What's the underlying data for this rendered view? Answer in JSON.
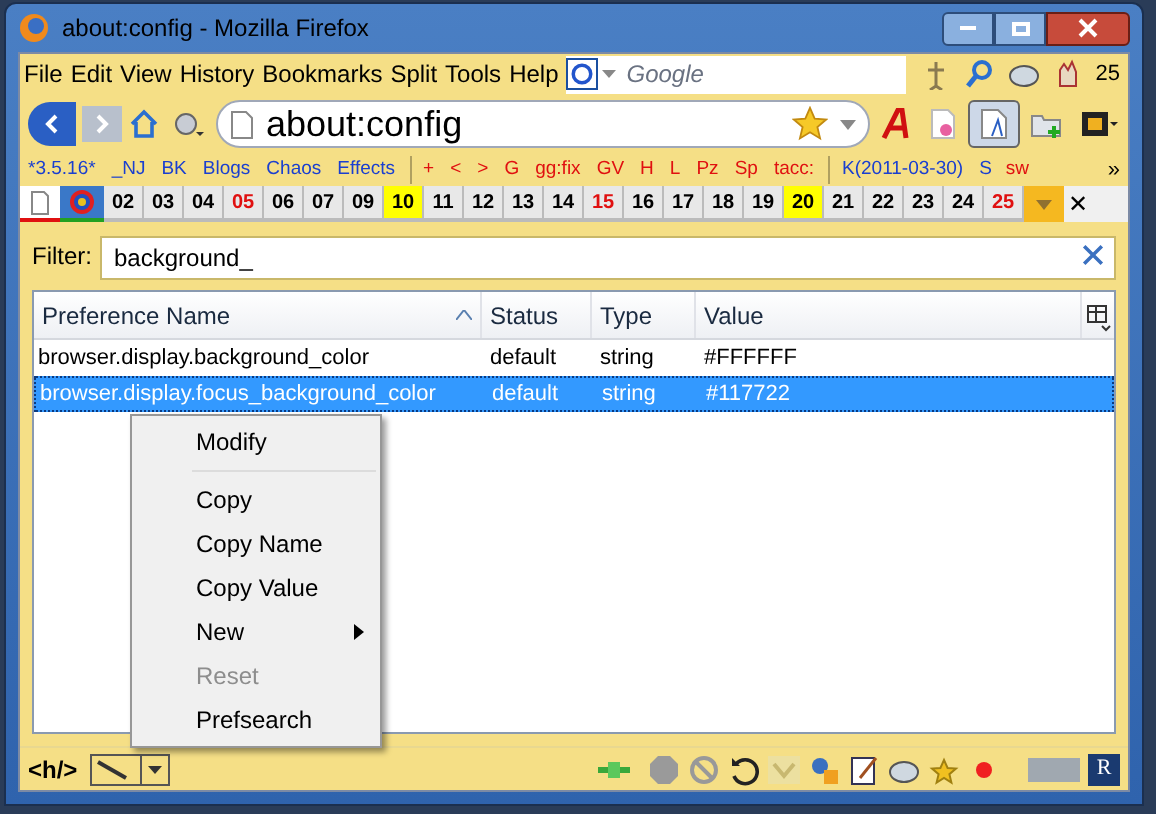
{
  "window": {
    "title": "about:config - Mozilla Firefox"
  },
  "menu": [
    "File",
    "Edit",
    "View",
    "History",
    "Bookmarks",
    "Split",
    "Tools",
    "Help"
  ],
  "search": {
    "placeholder": "Google"
  },
  "toolbar_count": "25",
  "url": "about:config",
  "bookmark_groups": [
    {
      "color": "#1a3fd0",
      "items": [
        "*3.5.16*",
        "_NJ",
        "BK",
        "Blogs",
        "Chaos",
        "Effects"
      ]
    },
    {
      "color": "#e01010",
      "items": [
        "+",
        "<",
        ">",
        "G",
        "gg:fix",
        "GV",
        "H",
        "L",
        "Pz",
        "Sp",
        "tacc:"
      ]
    },
    {
      "color": "#1a3fd0",
      "items": [
        "K(2011-03-30)",
        "S"
      ]
    },
    {
      "color": "#e01010",
      "items": [
        "sw"
      ]
    }
  ],
  "bookmarks_more": "»",
  "tabs": [
    {
      "kind": "page",
      "selected": true
    },
    {
      "kind": "target",
      "selected": false
    },
    {
      "kind": "text",
      "label": "02",
      "highlighted": false,
      "color": "#000000"
    },
    {
      "kind": "text",
      "label": "03",
      "highlighted": false,
      "color": "#000000"
    },
    {
      "kind": "text",
      "label": "04",
      "highlighted": false,
      "color": "#000000"
    },
    {
      "kind": "text",
      "label": "05",
      "highlighted": false,
      "color": "#e01010"
    },
    {
      "kind": "text",
      "label": "06",
      "highlighted": false,
      "color": "#000000"
    },
    {
      "kind": "text",
      "label": "07",
      "highlighted": false,
      "color": "#000000"
    },
    {
      "kind": "text",
      "label": "09",
      "highlighted": false,
      "color": "#000000"
    },
    {
      "kind": "text",
      "label": "10",
      "highlighted": true,
      "color": "#000000"
    },
    {
      "kind": "text",
      "label": "11",
      "highlighted": false,
      "color": "#000000"
    },
    {
      "kind": "text",
      "label": "12",
      "highlighted": false,
      "color": "#000000"
    },
    {
      "kind": "text",
      "label": "13",
      "highlighted": false,
      "color": "#000000"
    },
    {
      "kind": "text",
      "label": "14",
      "highlighted": false,
      "color": "#000000"
    },
    {
      "kind": "text",
      "label": "15",
      "highlighted": false,
      "color": "#e01010"
    },
    {
      "kind": "text",
      "label": "16",
      "highlighted": false,
      "color": "#000000"
    },
    {
      "kind": "text",
      "label": "17",
      "highlighted": false,
      "color": "#000000"
    },
    {
      "kind": "text",
      "label": "18",
      "highlighted": false,
      "color": "#000000"
    },
    {
      "kind": "text",
      "label": "19",
      "highlighted": false,
      "color": "#000000"
    },
    {
      "kind": "text",
      "label": "20",
      "highlighted": true,
      "color": "#000000"
    },
    {
      "kind": "text",
      "label": "21",
      "highlighted": false,
      "color": "#000000"
    },
    {
      "kind": "text",
      "label": "22",
      "highlighted": false,
      "color": "#000000"
    },
    {
      "kind": "text",
      "label": "23",
      "highlighted": false,
      "color": "#000000"
    },
    {
      "kind": "text",
      "label": "24",
      "highlighted": false,
      "color": "#000000"
    },
    {
      "kind": "text",
      "label": "25",
      "highlighted": false,
      "color": "#e01010"
    }
  ],
  "tab_close": "✕",
  "filter": {
    "label": "Filter:",
    "value": "background_"
  },
  "table": {
    "columns": [
      {
        "label": "Preference Name",
        "sorted": true
      },
      {
        "label": "Status",
        "sorted": false
      },
      {
        "label": "Type",
        "sorted": false
      },
      {
        "label": "Value",
        "sorted": false
      }
    ],
    "rows": [
      {
        "name": "browser.display.background_color",
        "status": "default",
        "type": "string",
        "value": "#FFFFFF",
        "selected": false
      },
      {
        "name": "browser.display.focus_background_color",
        "status": "default",
        "type": "string",
        "value": "#117722",
        "selected": true
      }
    ]
  },
  "context_menu": [
    {
      "kind": "item",
      "label": "Modify",
      "disabled": false,
      "submenu": false
    },
    {
      "kind": "separator"
    },
    {
      "kind": "item",
      "label": "Copy",
      "disabled": false,
      "submenu": false
    },
    {
      "kind": "item",
      "label": "Copy Name",
      "disabled": false,
      "submenu": false
    },
    {
      "kind": "item",
      "label": "Copy Value",
      "disabled": false,
      "submenu": false
    },
    {
      "kind": "item",
      "label": "New",
      "disabled": false,
      "submenu": true
    },
    {
      "kind": "item",
      "label": "Reset",
      "disabled": true,
      "submenu": false
    },
    {
      "kind": "item",
      "label": "Prefsearch",
      "disabled": false,
      "submenu": false
    }
  ],
  "status_bar": {
    "left_label": "<h/>",
    "logo_letter": "R"
  }
}
